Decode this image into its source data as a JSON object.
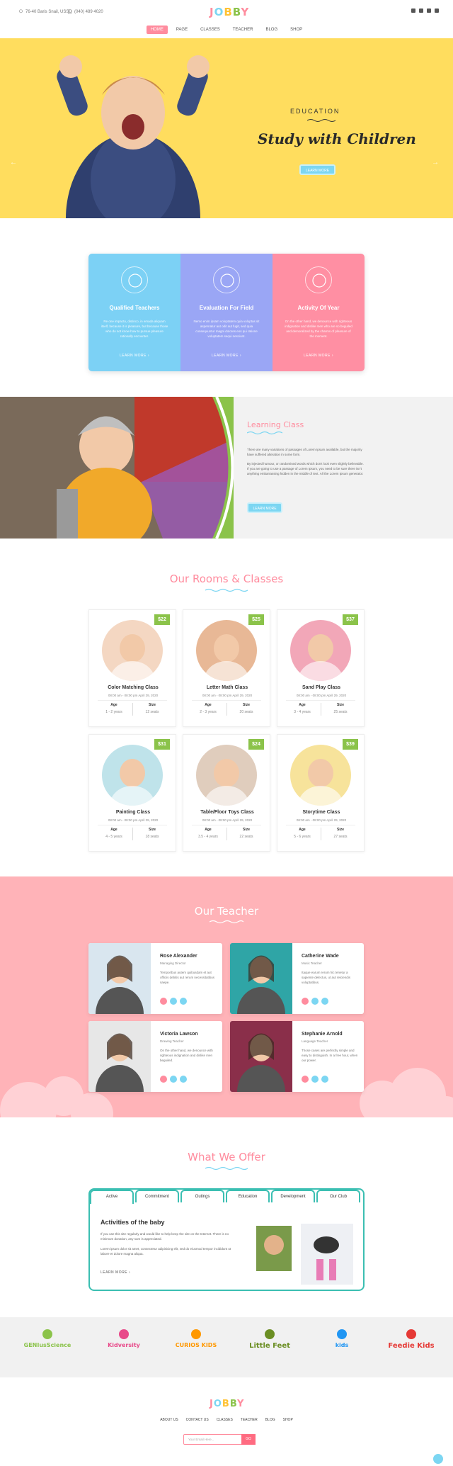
{
  "topbar": {
    "address": "76-40 Baris Snail, USSD",
    "phone": "(040) 489 4020"
  },
  "logo": {
    "letters": [
      "J",
      "O",
      "B",
      "B",
      "Y"
    ],
    "colors": [
      "#ff8c9e",
      "#7cd6f2",
      "#ffc233",
      "#8bc34a",
      "#ff8c9e"
    ]
  },
  "socials": [
    "facebook-icon",
    "twitter-icon",
    "instagram-icon",
    "search-icon"
  ],
  "nav": [
    {
      "label": "HOME",
      "active": true
    },
    {
      "label": "PAGE"
    },
    {
      "label": "CLASSES"
    },
    {
      "label": "TEACHER"
    },
    {
      "label": "BLOG"
    },
    {
      "label": "SHOP"
    }
  ],
  "hero": {
    "eyebrow": "EDUCATION",
    "title": "Study with Children",
    "button": "LEARN MORE",
    "prev": "←",
    "next": "→"
  },
  "features": [
    {
      "title": "Qualified Teachers",
      "desc": "Re one impactu, distinco, in emada aliquam itself, because it is pleasure, but because those who do not know how to pursue pleasure rationally encounter.",
      "link": "LEARN MORE",
      "color": "#7cd1f5",
      "icon": "graduation-cap-icon"
    },
    {
      "title": "Evaluation For Field",
      "desc": "Nemo enim ipsam voluptatem quia voluptas sit aspernatur aut odit aut fugit, sed quia consequuntur magni dolores eos qui ratione voluptatem sequi nesciunt.",
      "link": "LEARN MORE",
      "color": "#9aa6f5",
      "icon": "star-icon"
    },
    {
      "title": "Activity Of Year",
      "desc": "On the other hand, we denounce with righteous indignation and dislike men who are so beguiled and demoralized by the charms of pleasure of the moment.",
      "link": "LEARN MORE",
      "color": "#ff8fa3",
      "icon": "rocking-horse-icon"
    }
  ],
  "learning": {
    "title": "Learning Class",
    "p1": "There are many variations of passages of Lorem Ipsum available, but the majority have suffered alteration in some form.",
    "p2": "By injected humour, or randomised words which don't look even slightly believable. If you are going to use a passage of Lorem Ipsum, you need to be sure there isn't anything embarrassing hidden in the middle of text. All the Lorem Ipsum generator.",
    "button": "LEARN MORE"
  },
  "rooms": {
    "title": "Our Rooms & Classes",
    "age_label": "Age",
    "size_label": "Size",
    "classes": [
      {
        "name": "Color Matching Class",
        "date": "08:00 am - 08:00 pm   April 29, 2020",
        "price": "$22",
        "age": "1 - 2 years",
        "size": "12 seats",
        "img": "#f4d7c2"
      },
      {
        "name": "Letter Math Class",
        "date": "08:00 am - 08:00 pm   April 29, 2020",
        "price": "$25",
        "age": "2 - 3 years",
        "size": "20 seats",
        "img": "#e8b896"
      },
      {
        "name": "Sand Play Class",
        "date": "08:00 am - 08:00 pm   April 29, 2020",
        "price": "$37",
        "age": "3 - 4 years",
        "size": "25 seats",
        "img": "#f2a7b8"
      },
      {
        "name": "Painting Class",
        "date": "08:00 am - 08:00 pm   April 29, 2020",
        "price": "$31",
        "age": "4 - 5 years",
        "size": "18 seats",
        "img": "#bfe3ea"
      },
      {
        "name": "Table/Floor Toys Class",
        "date": "08:00 am - 08:00 pm   April 29, 2020",
        "price": "$24",
        "age": "3.5 - 4 years",
        "size": "22 seats",
        "img": "#e0cdbd"
      },
      {
        "name": "Storytime Class",
        "date": "08:00 am - 08:00 pm   April 29, 2020",
        "price": "$39",
        "age": "5 - 6 years",
        "size": "27 seats",
        "img": "#f7e39b"
      }
    ]
  },
  "teachers": {
    "title": "Our Teacher",
    "list": [
      {
        "name": "Rose Alexander",
        "role": "Managing Director",
        "desc": "Temporibus autem quibusdam et aut officiis debitis aut rerum necessitatibus saepe.",
        "img": "#d9e6ef"
      },
      {
        "name": "Catherine Wade",
        "role": "Music Teacher",
        "desc": "Itaque earum rerum hic tenetur a sapiente delectus, ut aut reiciendis voluptatibus.",
        "img": "#2fa5a6"
      },
      {
        "name": "Victoria Lawson",
        "role": "Drawing Teacher",
        "desc": "On the other hand, we denounce with righteous indignation and dislike men beguiled.",
        "img": "#e7e7e7"
      },
      {
        "name": "Stephanie Arnold",
        "role": "Language Teacher",
        "desc": "Those cases are perfectly simple and easy to distinguish. In a free hour, when our power.",
        "img": "#8a2f4a"
      }
    ]
  },
  "offer": {
    "title": "What We Offer",
    "tabs": [
      "Active",
      "Commitment",
      "Outings",
      "Education",
      "Development",
      "Our Club"
    ],
    "heading": "Activities of the baby",
    "p1": "If you use this site regularly and would like to help keep the site on the Internet. There is no minimum donation, any sum is appreciated.",
    "p2": "Lorem ipsum dolor sit amet, consectetur adipisicing elit, sed do eiusmod tempor incididunt ut labore et dolore magna aliqua.",
    "link": "LEARN MORE"
  },
  "brands": [
    {
      "name": "GENIusScience",
      "color": "#8bc34a"
    },
    {
      "name": "Kidversity",
      "color": "#e84a8a"
    },
    {
      "name": "CURIOS KIDS",
      "color": "#ff9800"
    },
    {
      "name": "Little Feet",
      "color": "#6b8e23"
    },
    {
      "name": "kids",
      "color": "#2196f3"
    },
    {
      "name": "Feedie Kids",
      "color": "#e53935"
    }
  ],
  "footer": {
    "nav": [
      "ABOUT US",
      "CONTACT US",
      "CLASSES",
      "TEACHER",
      "BLOG",
      "SHOP"
    ],
    "newsletter_placeholder": "Your Email Here...",
    "newsletter_button": "GO"
  }
}
